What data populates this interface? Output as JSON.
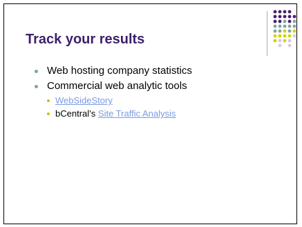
{
  "slide": {
    "title": "Track your results",
    "bullets": [
      {
        "text": "Web hosting company statistics"
      },
      {
        "text": "Commercial web analytic tools"
      }
    ],
    "sub_bullets": [
      {
        "prefix": "",
        "link": "WebSideStory"
      },
      {
        "prefix": "bCentral’s ",
        "link": "Site Traffic Analysis"
      }
    ]
  },
  "colors": {
    "title": "#3d1f6a",
    "level1_bullet": "#7fa7a3",
    "level2_bullet": "#c8c400",
    "link": "#7b9be0",
    "dot_purple": "#4a1f6e",
    "dot_teal": "#7fa7a3",
    "dot_yellow": "#d6d200",
    "dot_lilac": "#d5cbe0"
  }
}
